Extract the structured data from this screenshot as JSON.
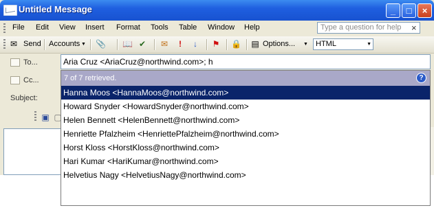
{
  "window": {
    "title": "Untitled Message",
    "controls": {
      "minimize": "_",
      "maximize": "□",
      "close": "×"
    }
  },
  "menu": {
    "items": [
      "File",
      "Edit",
      "View",
      "Insert",
      "Format",
      "Tools",
      "Table",
      "Window",
      "Help"
    ],
    "help_placeholder": "Type a question for help",
    "close_glyph": "×"
  },
  "toolbar": {
    "send": "Send",
    "accounts": "Accounts",
    "options": "Options...",
    "format": "HTML",
    "dropdown_glyph": "▼"
  },
  "headers": {
    "to_label": "To...",
    "cc_label": "Cc...",
    "subject_label": "Subject:",
    "to_value": "Aria Cruz <AriaCruz@northwind.com>; h"
  },
  "autocomplete": {
    "status": "7 of 7 retrieved.",
    "help_glyph": "?",
    "results": [
      "Hanna Moos <HannaMoos@northwind.com>",
      "Howard Snyder <HowardSnyder@northwind.com>",
      "Helen Bennett <HelenBennett@northwind.com>",
      "Henriette Pfalzheim <HenriettePfalzheim@northwind.com>",
      "Horst Kloss <HorstKloss@northwind.com>",
      "Hari Kumar <HariKumar@northwind.com>",
      "Helvetius Nagy <HelvetiusNagy@northwind.com>"
    ],
    "selected_index": 0
  },
  "colors": {
    "titlebar": "#1f5fe0",
    "selection": "#0a246a",
    "status_bar": "#a9a8c8"
  }
}
